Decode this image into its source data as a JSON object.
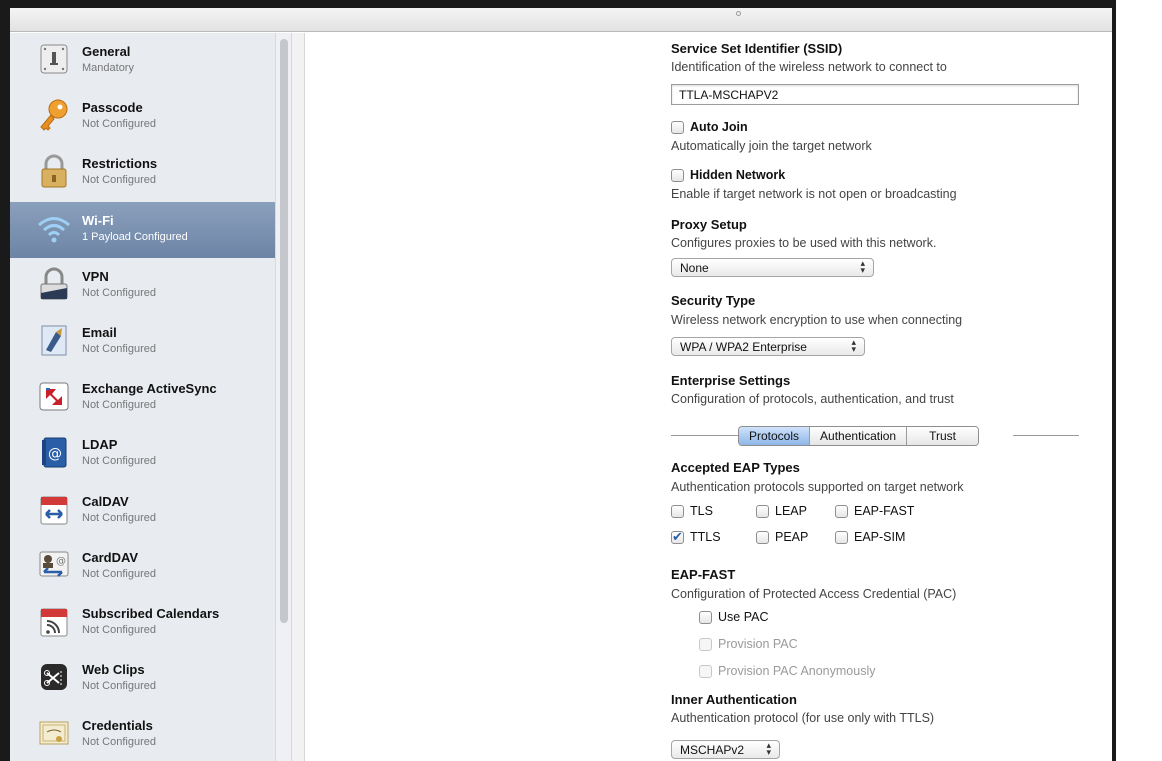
{
  "sidebar": {
    "items": [
      {
        "name": "General",
        "status": "Mandatory",
        "icon": "general-icon"
      },
      {
        "name": "Passcode",
        "status": "Not Configured",
        "icon": "key-icon"
      },
      {
        "name": "Restrictions",
        "status": "Not Configured",
        "icon": "padlock-icon"
      },
      {
        "name": "Wi-Fi",
        "status": "1 Payload Configured",
        "icon": "wifi-icon"
      },
      {
        "name": "VPN",
        "status": "Not Configured",
        "icon": "vpn-icon"
      },
      {
        "name": "Email",
        "status": "Not Configured",
        "icon": "email-icon"
      },
      {
        "name": "Exchange ActiveSync",
        "status": "Not Configured",
        "icon": "exchange-icon"
      },
      {
        "name": "LDAP",
        "status": "Not Configured",
        "icon": "ldap-icon"
      },
      {
        "name": "CalDAV",
        "status": "Not Configured",
        "icon": "caldav-icon"
      },
      {
        "name": "CardDAV",
        "status": "Not Configured",
        "icon": "carddav-icon"
      },
      {
        "name": "Subscribed Calendars",
        "status": "Not Configured",
        "icon": "subscribed-calendar-icon"
      },
      {
        "name": "Web Clips",
        "status": "Not Configured",
        "icon": "web-clip-icon"
      },
      {
        "name": "Credentials",
        "status": "Not Configured",
        "icon": "credentials-icon"
      }
    ]
  },
  "form": {
    "ssid": {
      "label": "Service Set Identifier (SSID)",
      "desc": "Identification of the wireless network to connect to",
      "value": "TTLA-MSCHAPV2"
    },
    "auto_join": {
      "label": "Auto Join",
      "desc": "Automatically join the target network",
      "checked": false
    },
    "hidden_network": {
      "label": "Hidden Network",
      "desc": "Enable if target network is not open or broadcasting",
      "checked": false
    },
    "proxy": {
      "label": "Proxy Setup",
      "desc": "Configures proxies to be used with this network.",
      "value": "None"
    },
    "security": {
      "label": "Security Type",
      "desc": "Wireless network encryption to use when connecting",
      "value": "WPA / WPA2 Enterprise"
    },
    "enterprise": {
      "label": "Enterprise Settings",
      "desc": "Configuration of protocols, authentication, and trust",
      "tabs": [
        "Protocols",
        "Authentication",
        "Trust"
      ],
      "active_tab": "Protocols"
    },
    "eap_types": {
      "label": "Accepted EAP Types",
      "desc": "Authentication protocols supported on target network",
      "options": [
        {
          "label": "TLS",
          "checked": false
        },
        {
          "label": "LEAP",
          "checked": false
        },
        {
          "label": "EAP-FAST",
          "checked": false
        },
        {
          "label": "TTLS",
          "checked": true
        },
        {
          "label": "PEAP",
          "checked": false
        },
        {
          "label": "EAP-SIM",
          "checked": false
        }
      ]
    },
    "eap_fast": {
      "label": "EAP-FAST",
      "desc": "Configuration of Protected Access Credential (PAC)",
      "use_pac": "Use PAC",
      "provision_pac": "Provision PAC",
      "provision_pac_anon": "Provision PAC Anonymously"
    },
    "inner_auth": {
      "label": "Inner Authentication",
      "desc": "Authentication protocol (for use only with TTLS)",
      "value": "MSCHAPv2"
    }
  },
  "colors": {
    "selection": "#7b90b0",
    "sidebar_bg": "#e8ebf0",
    "segment_active": "#a9c8f0",
    "check_accent": "#2b5fa8"
  }
}
